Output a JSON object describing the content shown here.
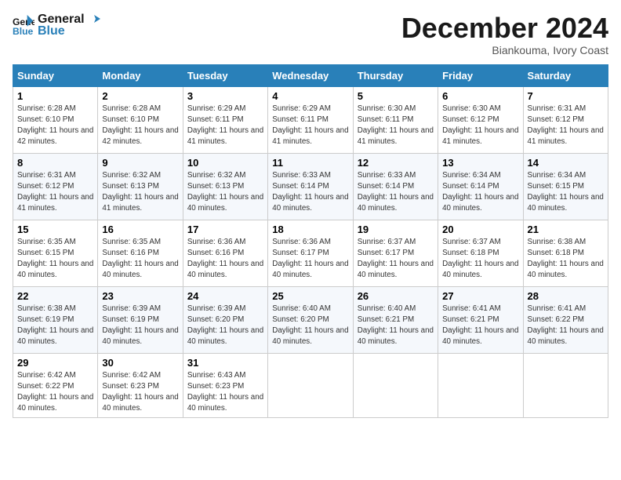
{
  "logo": {
    "line1": "General",
    "line2": "Blue"
  },
  "title": "December 2024",
  "location": "Biankouma, Ivory Coast",
  "days_of_week": [
    "Sunday",
    "Monday",
    "Tuesday",
    "Wednesday",
    "Thursday",
    "Friday",
    "Saturday"
  ],
  "weeks": [
    [
      {
        "day": "1",
        "sunrise": "6:28 AM",
        "sunset": "6:10 PM",
        "daylight": "11 hours and 42 minutes."
      },
      {
        "day": "2",
        "sunrise": "6:28 AM",
        "sunset": "6:10 PM",
        "daylight": "11 hours and 42 minutes."
      },
      {
        "day": "3",
        "sunrise": "6:29 AM",
        "sunset": "6:11 PM",
        "daylight": "11 hours and 41 minutes."
      },
      {
        "day": "4",
        "sunrise": "6:29 AM",
        "sunset": "6:11 PM",
        "daylight": "11 hours and 41 minutes."
      },
      {
        "day": "5",
        "sunrise": "6:30 AM",
        "sunset": "6:11 PM",
        "daylight": "11 hours and 41 minutes."
      },
      {
        "day": "6",
        "sunrise": "6:30 AM",
        "sunset": "6:12 PM",
        "daylight": "11 hours and 41 minutes."
      },
      {
        "day": "7",
        "sunrise": "6:31 AM",
        "sunset": "6:12 PM",
        "daylight": "11 hours and 41 minutes."
      }
    ],
    [
      {
        "day": "8",
        "sunrise": "6:31 AM",
        "sunset": "6:12 PM",
        "daylight": "11 hours and 41 minutes."
      },
      {
        "day": "9",
        "sunrise": "6:32 AM",
        "sunset": "6:13 PM",
        "daylight": "11 hours and 41 minutes."
      },
      {
        "day": "10",
        "sunrise": "6:32 AM",
        "sunset": "6:13 PM",
        "daylight": "11 hours and 40 minutes."
      },
      {
        "day": "11",
        "sunrise": "6:33 AM",
        "sunset": "6:14 PM",
        "daylight": "11 hours and 40 minutes."
      },
      {
        "day": "12",
        "sunrise": "6:33 AM",
        "sunset": "6:14 PM",
        "daylight": "11 hours and 40 minutes."
      },
      {
        "day": "13",
        "sunrise": "6:34 AM",
        "sunset": "6:14 PM",
        "daylight": "11 hours and 40 minutes."
      },
      {
        "day": "14",
        "sunrise": "6:34 AM",
        "sunset": "6:15 PM",
        "daylight": "11 hours and 40 minutes."
      }
    ],
    [
      {
        "day": "15",
        "sunrise": "6:35 AM",
        "sunset": "6:15 PM",
        "daylight": "11 hours and 40 minutes."
      },
      {
        "day": "16",
        "sunrise": "6:35 AM",
        "sunset": "6:16 PM",
        "daylight": "11 hours and 40 minutes."
      },
      {
        "day": "17",
        "sunrise": "6:36 AM",
        "sunset": "6:16 PM",
        "daylight": "11 hours and 40 minutes."
      },
      {
        "day": "18",
        "sunrise": "6:36 AM",
        "sunset": "6:17 PM",
        "daylight": "11 hours and 40 minutes."
      },
      {
        "day": "19",
        "sunrise": "6:37 AM",
        "sunset": "6:17 PM",
        "daylight": "11 hours and 40 minutes."
      },
      {
        "day": "20",
        "sunrise": "6:37 AM",
        "sunset": "6:18 PM",
        "daylight": "11 hours and 40 minutes."
      },
      {
        "day": "21",
        "sunrise": "6:38 AM",
        "sunset": "6:18 PM",
        "daylight": "11 hours and 40 minutes."
      }
    ],
    [
      {
        "day": "22",
        "sunrise": "6:38 AM",
        "sunset": "6:19 PM",
        "daylight": "11 hours and 40 minutes."
      },
      {
        "day": "23",
        "sunrise": "6:39 AM",
        "sunset": "6:19 PM",
        "daylight": "11 hours and 40 minutes."
      },
      {
        "day": "24",
        "sunrise": "6:39 AM",
        "sunset": "6:20 PM",
        "daylight": "11 hours and 40 minutes."
      },
      {
        "day": "25",
        "sunrise": "6:40 AM",
        "sunset": "6:20 PM",
        "daylight": "11 hours and 40 minutes."
      },
      {
        "day": "26",
        "sunrise": "6:40 AM",
        "sunset": "6:21 PM",
        "daylight": "11 hours and 40 minutes."
      },
      {
        "day": "27",
        "sunrise": "6:41 AM",
        "sunset": "6:21 PM",
        "daylight": "11 hours and 40 minutes."
      },
      {
        "day": "28",
        "sunrise": "6:41 AM",
        "sunset": "6:22 PM",
        "daylight": "11 hours and 40 minutes."
      }
    ],
    [
      {
        "day": "29",
        "sunrise": "6:42 AM",
        "sunset": "6:22 PM",
        "daylight": "11 hours and 40 minutes."
      },
      {
        "day": "30",
        "sunrise": "6:42 AM",
        "sunset": "6:23 PM",
        "daylight": "11 hours and 40 minutes."
      },
      {
        "day": "31",
        "sunrise": "6:43 AM",
        "sunset": "6:23 PM",
        "daylight": "11 hours and 40 minutes."
      },
      null,
      null,
      null,
      null
    ]
  ]
}
